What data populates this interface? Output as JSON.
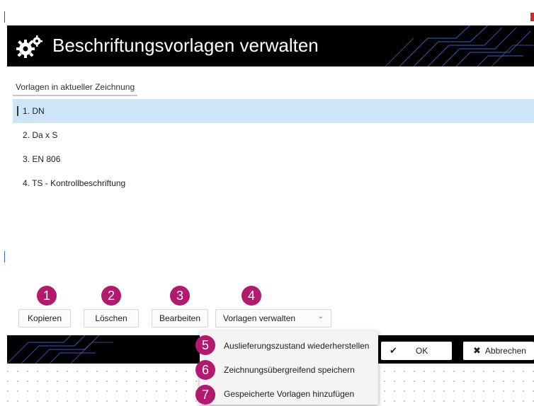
{
  "window": {
    "title": "Beschriftungsvorlagen verwalten",
    "icon": "gears-icon"
  },
  "tab": {
    "label": "Vorlagen in aktueller Zeichnung"
  },
  "templates": [
    {
      "label": "1. DN",
      "selected": true
    },
    {
      "label": "2. Da x S",
      "selected": false
    },
    {
      "label": "3. EN 806",
      "selected": false
    },
    {
      "label": "4. TS - Kontrollbeschriftung",
      "selected": false
    }
  ],
  "toolbar": {
    "copy_label": "Kopieren",
    "delete_label": "Löschen",
    "edit_label": "Bearbeiten",
    "manage_label": "Vorlagen verwalten"
  },
  "badges": [
    "1",
    "2",
    "3",
    "4",
    "5",
    "6",
    "7"
  ],
  "dropdown_menu": {
    "items": [
      "Auslieferungszustand wiederherstellen",
      "Zeichnungsübergreifend speichern",
      "Gespeicherte Vorlagen hinzufügen"
    ]
  },
  "footer": {
    "ok_label": "OK",
    "cancel_label": "Abbrechen"
  },
  "colors": {
    "badge": "#b3196c",
    "selection": "#cde6f7",
    "titlebar": "#000000",
    "accent_deco": "#3a5fd0"
  }
}
